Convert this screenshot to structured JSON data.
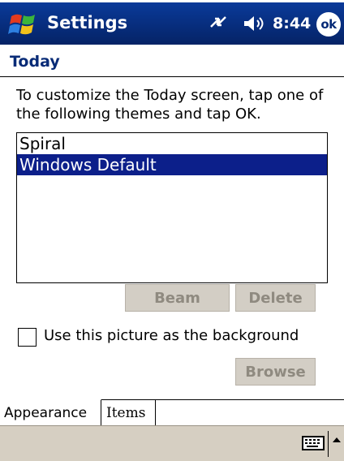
{
  "titlebar": {
    "app_title": "Settings",
    "time": "8:44",
    "ok_label": "ok"
  },
  "page": {
    "title": "Today",
    "instructions": "To customize the Today screen, tap one of the following themes and tap OK."
  },
  "themes": [
    {
      "label": "Spiral",
      "selected": false
    },
    {
      "label": "Windows Default",
      "selected": true
    }
  ],
  "buttons": {
    "beam": "Beam",
    "delete": "Delete",
    "browse": "Browse"
  },
  "checkbox": {
    "label": "Use this picture as the background",
    "checked": false
  },
  "tabs": [
    {
      "label": "Appearance",
      "active": true
    },
    {
      "label": "Items",
      "active": false
    }
  ],
  "colors": {
    "titlebar": "#082b77",
    "selection": "#0c1f8a",
    "menubar": "#d6cfc2",
    "disabled_button": "#d3cec5"
  },
  "icons": {
    "start": "windows-flag-icon",
    "connectivity": "connectivity-arrows-icon",
    "volume": "speaker-icon",
    "sip": "keyboard-icon"
  }
}
